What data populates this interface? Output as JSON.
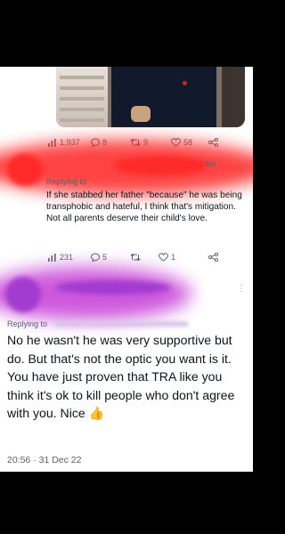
{
  "tweet_top": {
    "stats": {
      "views": "1,937",
      "replies": "8",
      "retweets": "9",
      "likes": "58"
    }
  },
  "reply_one": {
    "time": "4m",
    "replying_label": "Replying to",
    "body": "If she stabbed her father \"because\" he was being transphobic and hateful, I think that's mitigation. Not all parents deserve their child's love.",
    "stats": {
      "views": "231",
      "replies": "5",
      "retweets": "",
      "likes": "1"
    }
  },
  "reply_two": {
    "replying_label": "Replying to",
    "body": "No he wasn't he was very supportive but do. But that's not the optic you want is it. You have just proven that TRA like you think it's ok to kill people who don't agree with you. Nice",
    "emoji": "👍",
    "timestamp": "20:56 · 31 Dec 22"
  },
  "more_glyph": "⋮",
  "colors": {
    "muted": "#536471",
    "text": "#0f1419",
    "red_redaction": "#ff2222",
    "purple_redaction": "#c63bd6",
    "thumb": "#f4b400"
  }
}
